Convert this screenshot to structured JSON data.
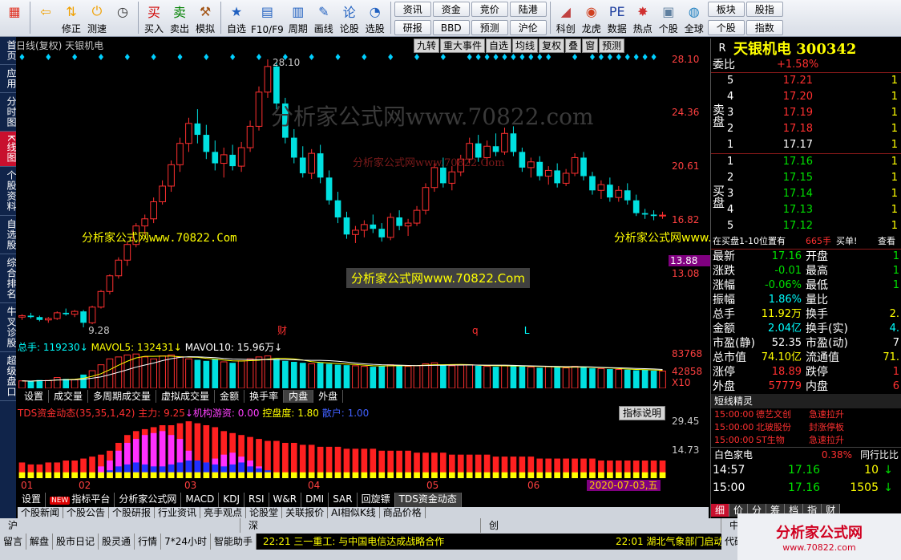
{
  "toolbar": {
    "buttons": [
      {
        "label": "",
        "icon": "windows-icon"
      },
      {
        "label": "",
        "icon": "back-arrow-icon"
      },
      {
        "label": "修正",
        "icon": "up-down-icon"
      },
      {
        "label": "测速",
        "icon": "power-icon"
      },
      {
        "label": "",
        "icon": "clock-icon"
      },
      {
        "label": "买入",
        "icon": "buy-icon"
      },
      {
        "label": "卖出",
        "icon": "sell-icon"
      },
      {
        "label": "模拟",
        "icon": "hammer-icon"
      },
      {
        "label": "自选",
        "icon": "star-icon"
      },
      {
        "label": "F10/F9",
        "icon": "f10-icon"
      },
      {
        "label": "周期",
        "icon": "period-icon"
      },
      {
        "label": "画线",
        "icon": "pencil-icon"
      },
      {
        "label": "论股",
        "icon": "talk-icon"
      },
      {
        "label": "选股",
        "icon": "gauge-icon"
      }
    ],
    "pairs": [
      [
        "资讯",
        "研报"
      ],
      [
        "资金",
        "BBD"
      ],
      [
        "竞价",
        "预测"
      ],
      [
        "陆港",
        "沪伦"
      ]
    ],
    "more_buttons": [
      {
        "label": "科创",
        "icon": "chart-icon"
      },
      {
        "label": "龙虎",
        "icon": "tiger-icon"
      },
      {
        "label": "数据",
        "icon": "pe-icon"
      },
      {
        "label": "热点",
        "icon": "hot-icon"
      },
      {
        "label": "个股",
        "icon": "stock-icon"
      },
      {
        "label": "全球",
        "icon": "globe-icon"
      }
    ],
    "right_pairs": [
      [
        "板块",
        "个股"
      ],
      [
        "股指",
        "指数"
      ]
    ]
  },
  "left_tabs": [
    "首页",
    "应用",
    "分时图",
    "K线图",
    "个股资料",
    "自选股",
    "综合排名",
    "牛叉诊股",
    "超级盘口"
  ],
  "chart": {
    "header": "日线(复权)  天银机电",
    "tools": [
      "九转",
      "重大事件",
      "自选",
      "均线",
      "复权",
      "叠",
      "窗",
      "预测"
    ],
    "axis_labels": [
      "28.10",
      "24.36",
      "20.61",
      "16.82",
      "13.08"
    ],
    "cursor_price": "13.88",
    "high_label": "28.10",
    "low_label": "9.28",
    "markers": [
      {
        "text": "财",
        "color": "#ff3030"
      },
      {
        "text": "q",
        "color": "#ff3030"
      },
      {
        "text": "L",
        "color": "#00ffff"
      }
    ],
    "watermarks": [
      "分析家公式网www.70822.com",
      "分析家公式网www.70822.Com",
      "分析家公式网www.70822.Com",
      "分析家公式网www.70822.Com",
      "分析家公式网www.70822.com"
    ]
  },
  "chart_data": {
    "type": "candlestick",
    "title": "日线(复权) 天银机电",
    "ylim": [
      9.28,
      28.1
    ],
    "x_months": [
      "01",
      "02",
      "03",
      "04",
      "05",
      "06"
    ],
    "ohlc": [
      [
        10.0,
        10.2,
        9.8,
        10.1
      ],
      [
        10.1,
        10.3,
        9.9,
        10.0
      ],
      [
        10.0,
        10.1,
        9.7,
        9.8
      ],
      [
        9.8,
        10.0,
        9.6,
        9.9
      ],
      [
        9.9,
        10.4,
        9.8,
        10.3
      ],
      [
        10.3,
        10.6,
        10.1,
        10.2
      ],
      [
        10.2,
        10.5,
        10.0,
        10.4
      ],
      [
        10.4,
        10.5,
        9.28,
        9.6
      ],
      [
        9.6,
        10.8,
        9.5,
        10.7
      ],
      [
        10.7,
        11.9,
        10.6,
        11.8
      ],
      [
        11.8,
        13.0,
        11.6,
        12.9
      ],
      [
        12.9,
        14.2,
        12.7,
        14.0
      ],
      [
        14.0,
        15.3,
        13.6,
        15.1
      ],
      [
        15.1,
        16.6,
        14.9,
        16.4
      ],
      [
        16.4,
        17.2,
        15.8,
        16.9
      ],
      [
        16.9,
        18.4,
        16.6,
        18.1
      ],
      [
        18.1,
        19.6,
        17.9,
        19.2
      ],
      [
        19.2,
        21.0,
        18.8,
        20.7
      ],
      [
        20.7,
        22.6,
        20.2,
        22.2
      ],
      [
        22.2,
        24.0,
        21.6,
        23.6
      ],
      [
        23.6,
        24.6,
        22.2,
        22.8
      ],
      [
        22.8,
        23.5,
        21.1,
        21.6
      ],
      [
        21.6,
        22.4,
        20.3,
        20.8
      ],
      [
        20.8,
        21.9,
        19.8,
        21.4
      ],
      [
        21.4,
        22.1,
        20.3,
        20.6
      ],
      [
        20.6,
        22.3,
        20.2,
        21.9
      ],
      [
        21.9,
        23.8,
        21.6,
        23.4
      ],
      [
        23.4,
        26.2,
        23.1,
        25.8
      ],
      [
        25.8,
        28.1,
        25.4,
        27.6
      ],
      [
        27.6,
        27.9,
        24.6,
        25.0
      ],
      [
        25.0,
        25.4,
        22.2,
        22.6
      ],
      [
        22.6,
        23.2,
        20.8,
        21.2
      ],
      [
        21.2,
        22.0,
        19.8,
        20.1
      ],
      [
        20.1,
        21.8,
        19.7,
        21.5
      ],
      [
        21.5,
        22.1,
        19.4,
        19.8
      ],
      [
        19.8,
        20.3,
        17.9,
        18.2
      ],
      [
        18.2,
        18.8,
        16.6,
        17.0
      ],
      [
        17.0,
        17.4,
        15.5,
        15.8
      ],
      [
        15.8,
        16.4,
        15.2,
        16.1
      ],
      [
        16.1,
        16.8,
        15.6,
        16.5
      ],
      [
        16.5,
        17.2,
        15.9,
        16.2
      ],
      [
        16.2,
        16.6,
        15.3,
        15.6
      ],
      [
        15.6,
        17.3,
        15.4,
        17.0
      ],
      [
        17.0,
        17.5,
        16.1,
        16.4
      ],
      [
        16.4,
        16.9,
        15.7,
        16.6
      ],
      [
        16.6,
        17.8,
        16.4,
        17.5
      ],
      [
        17.5,
        19.4,
        17.2,
        19.1
      ],
      [
        19.1,
        20.8,
        18.8,
        20.5
      ],
      [
        20.5,
        21.2,
        19.1,
        19.4
      ],
      [
        19.4,
        20.6,
        18.9,
        20.2
      ],
      [
        20.2,
        21.4,
        19.9,
        21.1
      ],
      [
        21.1,
        22.6,
        20.8,
        22.2
      ],
      [
        22.2,
        22.8,
        20.9,
        21.2
      ],
      [
        21.2,
        22.4,
        20.6,
        22.0
      ],
      [
        22.0,
        22.9,
        21.3,
        21.6
      ],
      [
        21.6,
        23.3,
        21.4,
        22.9
      ],
      [
        22.9,
        23.4,
        21.3,
        21.6
      ],
      [
        21.6,
        21.9,
        20.2,
        20.5
      ],
      [
        20.5,
        21.2,
        19.8,
        20.9
      ],
      [
        20.9,
        21.3,
        19.6,
        19.9
      ],
      [
        19.9,
        20.6,
        19.3,
        20.3
      ],
      [
        20.3,
        20.8,
        19.1,
        19.4
      ],
      [
        19.4,
        20.4,
        19.2,
        20.1
      ],
      [
        20.1,
        21.5,
        19.9,
        21.2
      ],
      [
        21.2,
        21.6,
        19.6,
        19.9
      ],
      [
        19.9,
        20.2,
        18.6,
        18.9
      ],
      [
        18.9,
        19.6,
        18.3,
        19.3
      ],
      [
        19.3,
        19.8,
        18.1,
        18.4
      ],
      [
        18.4,
        19.2,
        18.1,
        18.9
      ],
      [
        18.9,
        19.4,
        17.9,
        18.2
      ],
      [
        18.2,
        18.6,
        17.1,
        17.3
      ],
      [
        17.3,
        17.6,
        16.9,
        17.2
      ],
      [
        17.2,
        17.5,
        16.8,
        17.1
      ],
      [
        17.1,
        17.4,
        16.9,
        17.16
      ]
    ],
    "volume_series": {
      "name": "总手",
      "latest": "119230",
      "ylim": [
        0,
        83768
      ],
      "axis_labels": [
        "83768",
        "42858",
        "X10"
      ]
    },
    "volume": [
      38,
      36,
      42,
      40,
      55,
      48,
      44,
      70,
      90,
      120,
      150,
      160,
      170,
      175,
      160,
      150,
      165,
      170,
      160,
      150,
      145,
      140,
      150,
      135,
      130,
      140,
      150,
      160,
      165,
      150,
      140,
      135,
      130,
      125,
      130,
      125,
      120,
      118,
      115,
      112,
      110,
      115,
      120,
      118,
      112,
      115,
      125,
      130,
      120,
      115,
      118,
      120,
      115,
      112,
      110,
      115,
      118,
      112,
      108,
      105,
      110,
      108,
      104,
      112,
      108,
      102,
      100,
      98,
      96,
      95,
      92,
      94,
      90,
      88
    ],
    "vol_ma_labels": {
      "mavol5": "132431",
      "mavol10": "15.96万"
    },
    "tds": {
      "name": "TDS资金动态",
      "params": "(35,35,1,42)",
      "main_force": "9.25",
      "inst": "0.00",
      "control": "1.80",
      "retail": "1.00",
      "axis_labels": [
        "29.45",
        "14.73"
      ],
      "ylim": [
        0,
        29.45
      ],
      "red": [
        8,
        7,
        7,
        8,
        8,
        9,
        9,
        10,
        11,
        12,
        14,
        18,
        22,
        24,
        25,
        26,
        27,
        27,
        28,
        29,
        28,
        27,
        26,
        24,
        23,
        22,
        21,
        20,
        19,
        19,
        18,
        18,
        17,
        17,
        16,
        16,
        16,
        15,
        15,
        15,
        15,
        14,
        14,
        14,
        14,
        13,
        13,
        13,
        13,
        12,
        12,
        12,
        12,
        12,
        11,
        11,
        11,
        11,
        11,
        10,
        10,
        10,
        10,
        10,
        10,
        10,
        9,
        9,
        9,
        9,
        9,
        9,
        9,
        9
      ],
      "magenta": [
        0,
        0,
        0,
        0,
        0,
        0,
        0,
        0,
        0,
        6,
        9,
        14,
        18,
        20,
        22,
        23,
        24,
        22,
        20,
        14,
        9,
        8,
        10,
        12,
        13,
        11,
        9,
        6,
        3,
        0,
        0,
        0,
        0,
        0,
        0,
        0,
        0,
        0,
        0,
        0,
        0,
        0,
        0,
        0,
        0,
        0,
        0,
        0,
        0,
        0,
        0,
        0,
        0,
        0,
        0,
        0,
        0,
        0,
        0,
        0,
        0,
        0,
        0,
        0,
        0,
        0,
        0,
        0,
        0,
        0,
        0,
        0,
        0,
        0
      ],
      "blue": [
        0,
        0,
        0,
        0,
        0,
        0,
        0,
        0,
        0,
        0,
        1,
        3,
        4,
        5,
        4,
        3,
        3,
        4,
        5,
        6,
        6,
        5,
        4,
        3,
        4,
        5,
        3,
        2,
        1,
        0,
        0,
        0,
        0,
        0,
        0,
        0,
        0,
        0,
        0,
        0,
        0,
        0,
        0,
        0,
        0,
        0,
        0,
        0,
        0,
        0,
        0,
        0,
        0,
        0,
        0,
        0,
        0,
        0,
        0,
        0,
        0,
        0,
        0,
        0,
        0,
        0,
        0,
        0,
        0,
        0,
        0,
        0,
        0,
        0
      ],
      "yellow": [
        3,
        3,
        3,
        3,
        3,
        3,
        3,
        3,
        3,
        3,
        3,
        3,
        3,
        3,
        3,
        3,
        3,
        3,
        3,
        3,
        3,
        3,
        3,
        3,
        3,
        3,
        3,
        3,
        3,
        3,
        3,
        3,
        3,
        3,
        3,
        3,
        3,
        3,
        3,
        3,
        3,
        3,
        3,
        3,
        3,
        3,
        3,
        3,
        3,
        3,
        3,
        3,
        3,
        3,
        3,
        3,
        3,
        3,
        3,
        3,
        3,
        3,
        3,
        3,
        3,
        3,
        3,
        3,
        3,
        3,
        3,
        3,
        3,
        3
      ]
    }
  },
  "volume_tabs": [
    "设置",
    "成交量",
    "多周期成交量",
    "虚拟成交量",
    "金额",
    "换手率",
    "内盘",
    "外盘"
  ],
  "indicator_button": "指标说明",
  "date_tag": "2020-07-03,五",
  "indicator_tabs": [
    "设置",
    "指标平台",
    "分析家公式网",
    "MACD",
    "KDJ",
    "RSI",
    "W&R",
    "DMI",
    "SAR",
    "回旋镖",
    "TDS资金动态"
  ],
  "new_badge": "NEW",
  "info_tabs": [
    "个股新闻",
    "个股公告",
    "个股研报",
    "行业资讯",
    "亮手观点",
    "论股堂",
    "关联报价",
    "AI相似K线",
    "商品价格"
  ],
  "quote": {
    "code_label": "R",
    "name": "天银机电 300342",
    "weibi_label": "委比",
    "weibi": "+1.58%",
    "sell_side": "卖盘",
    "buy_side": "买盘",
    "asks": [
      {
        "lvl": "5",
        "px": "17.21",
        "vol": "1"
      },
      {
        "lvl": "4",
        "px": "17.20",
        "vol": "1"
      },
      {
        "lvl": "3",
        "px": "17.19",
        "vol": "1"
      },
      {
        "lvl": "2",
        "px": "17.18",
        "vol": "1"
      },
      {
        "lvl": "1",
        "px": "17.17",
        "vol": "1"
      }
    ],
    "bids": [
      {
        "lvl": "1",
        "px": "17.16",
        "vol": "1"
      },
      {
        "lvl": "2",
        "px": "17.15",
        "vol": "1"
      },
      {
        "lvl": "3",
        "px": "17.14",
        "vol": "1"
      },
      {
        "lvl": "4",
        "px": "17.13",
        "vol": "1"
      },
      {
        "lvl": "5",
        "px": "17.12",
        "vol": "1"
      }
    ],
    "bid_notice": "在买盘1-10位置有",
    "bid_notice_val": "665手",
    "bid_notice_tag": "买单!",
    "bid_notice_view": "查看",
    "stats": [
      {
        "l": "最新",
        "v": "17.16",
        "c": "green",
        "l2": "开盘",
        "v2": "1"
      },
      {
        "l": "涨跌",
        "v": "-0.01",
        "c": "green",
        "l2": "最高",
        "v2": "1"
      },
      {
        "l": "涨幅",
        "v": "-0.06%",
        "c": "green",
        "l2": "最低",
        "v2": "1"
      },
      {
        "l": "振幅",
        "v": "1.86%",
        "c": "cyan",
        "l2": "量比",
        "v2": ""
      },
      {
        "l": "总手",
        "v": "11.92万",
        "c": "yellow",
        "l2": "换手",
        "v2": "2."
      },
      {
        "l": "金额",
        "v": "2.04亿",
        "c": "cyan",
        "l2": "换手(实)",
        "v2": "4."
      },
      {
        "l": "市盈(静)",
        "v": "52.35",
        "c": "white",
        "l2": "市盈(动)",
        "v2": "7"
      },
      {
        "l": "总市值",
        "v": "74.10亿",
        "c": "yellow",
        "l2": "流通值",
        "v2": "71."
      },
      {
        "l": "涨停",
        "v": "18.89",
        "c": "red",
        "l2": "跌停",
        "v2": "1"
      },
      {
        "l": "外盘",
        "v": "57779",
        "c": "red",
        "l2": "内盘",
        "v2": "6"
      }
    ],
    "flash_title": "短线精灵",
    "flash": [
      {
        "t": "15:00:00",
        "n": "德艺文创",
        "e": "急速拉升"
      },
      {
        "t": "15:00:00",
        "n": "北玻股份",
        "e": "封涨停板"
      },
      {
        "t": "15:00:00",
        "n": "ST生物",
        "e": "急速拉升"
      }
    ],
    "sector_name": "白色家电",
    "sector_chg": "0.38%",
    "sector_rank": "同行比比",
    "ticks": [
      {
        "t": "14:57",
        "p": "17.16",
        "v": "10",
        "dir": "down"
      },
      {
        "t": "15:00",
        "p": "17.16",
        "v": "1505",
        "dir": "down"
      }
    ],
    "tabs": [
      "细",
      "价",
      "分",
      "筹",
      "档",
      "指",
      "财"
    ]
  },
  "status": {
    "markets": [
      "沪",
      "深",
      "创",
      "中小"
    ],
    "items": [
      "留言",
      "解盘",
      "股市日记",
      "股灵通",
      "行情",
      "7*24小时",
      "智能助手"
    ],
    "news1": "22:21  三一重工: 与中国电信达成战略合作",
    "news2": "22:01  湖北气象部门启动",
    "code_label": "代码/名称/简",
    "logo_text": "分析家公式网",
    "logo_url": "www.70822.com"
  }
}
